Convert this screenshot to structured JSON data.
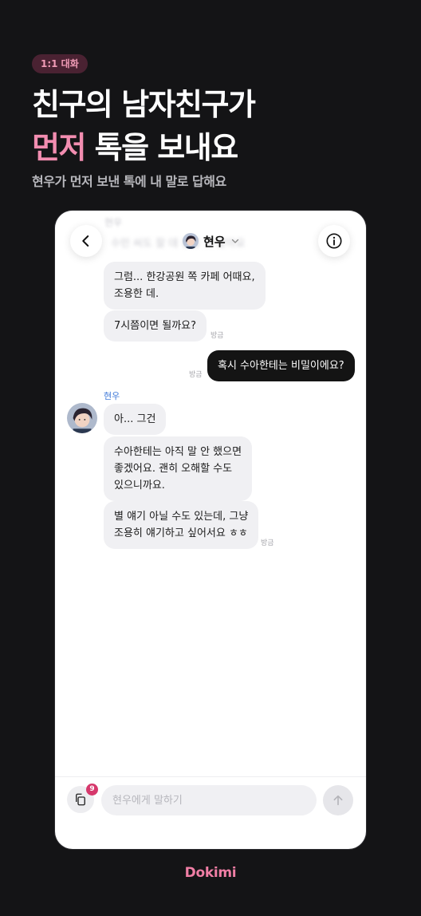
{
  "badge": "1:1 대화",
  "headline": {
    "line1": "친구의 남자친구가",
    "line2_highlight": "먼저",
    "line2_rest": "톡을 보내요"
  },
  "subhead": "현우가 먼저 보낸 톡에 내 말로 답해요",
  "chat": {
    "title": "현우",
    "back_icon": "chevron-left-icon",
    "info_icon": "info-icon",
    "faded_name": "현우",
    "faded_text": "수민 씨도 잘 데 좋을 것 같아요",
    "messages_top": [
      {
        "text": "그럼... 한강공원 쪽 카페 어때요,\n조용한 데."
      },
      {
        "text": "7시쯤이면 될까요?",
        "time": "방금"
      }
    ],
    "my_message": {
      "text": "혹시 수아한테는 비밀이에요?",
      "time": "방금"
    },
    "sender_name": "현우",
    "messages_bottom": [
      {
        "text": "아... 그건"
      },
      {
        "text": "수아한테는 아직 말 안 했으면\n좋겠어요. 괜히 오해할 수도\n있으니까요."
      },
      {
        "text": "별 얘기 아닐 수도 있는데, 그냥\n조용히 얘기하고 싶어서요 ㅎㅎ",
        "time": "방금"
      }
    ],
    "input_placeholder": "현우에게 말하기",
    "copy_badge_count": "9",
    "send_icon": "arrow-up-icon"
  },
  "brand": "Dokimi",
  "colors": {
    "background": "#141416",
    "accent_pink": "#f28db0",
    "my_bubble": "#141414",
    "other_bubble": "#f0f0f3",
    "sender_name": "#3f79d8",
    "badge_count": "#d6386c"
  }
}
